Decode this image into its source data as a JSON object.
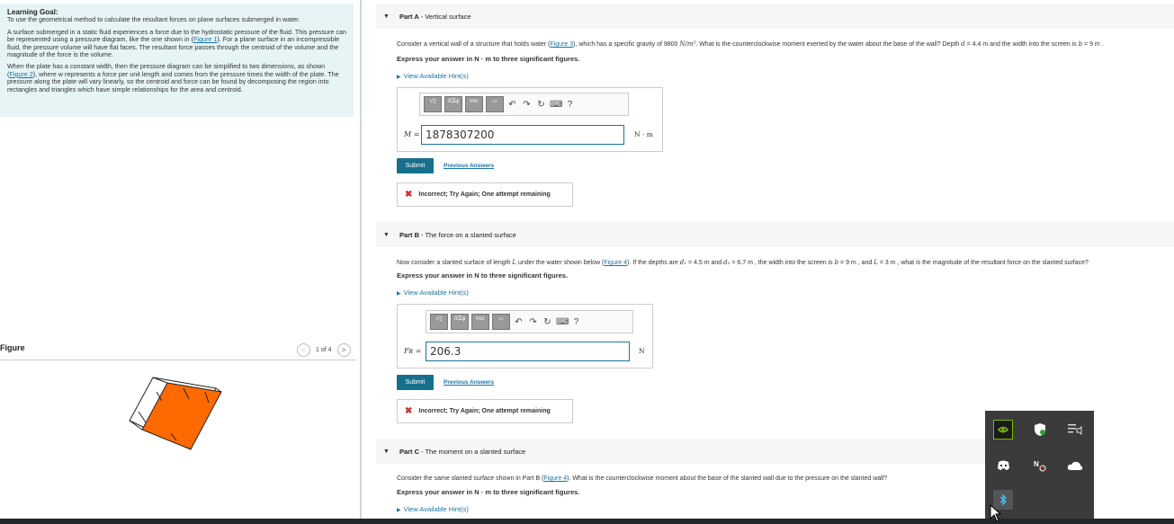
{
  "left": {
    "goal_head": "Learning Goal:",
    "goal_sub": "To use the geometrical method to calculate the resultant forces on plane surfaces submerged in water.",
    "p1_a": "A surface submerged in a static fluid experiences a force due to the hydrostatic pressure of the fluid. This pressure can be represented using a pressure diagram, like the one shown in (",
    "p1_link": "Figure 1",
    "p1_b": "). For a plane surface in an incompressible fluid, the pressure volume will have flat faces. The resultant force passes through the centroid of the volume and the magnitude of the force is the volume.",
    "p2_a": "When the plate has a constant width, then the pressure diagram can be simplified to two dimensions, as shown (",
    "p2_link": "Figure 2",
    "p2_b": "), where w represents a force per unit length and comes from the pressure times the width of the plate. The pressure along the plate will vary linearly, so the centroid and force can be found by decomposing the region into rectangles and triangles which have simple relationships for the area and centroid.",
    "figure_label": "Figure",
    "pager": "1 of 4",
    "prev_arrow": "<",
    "next_arrow": ">"
  },
  "partA": {
    "part": "Part A",
    "title": " - Vertical surface",
    "q_a": "Consider a vertical wall of a structure that holds water (",
    "q_link": "Figure 3",
    "q_b": "), which has a specific gravity of 9800 ",
    "q_unit": "N/m³",
    "q_c": ". What is the counterclockwise moment exerted by the water about the base of the wall? Depth ",
    "q_d": "d",
    "q_e": " = 4.4  m and the width into the screen is ",
    "q_f": "b",
    "q_g": " = 9  m .",
    "instruction": "Express your answer in N · m to three significant figures.",
    "hint": "View Available Hint(s)",
    "var": "M =",
    "value": "1878307200",
    "unit": "N · m",
    "submit": "Submit",
    "prev": "Previous Answers",
    "feedback": "Incorrect; Try Again; One attempt remaining"
  },
  "partB": {
    "part": "Part B",
    "title": " - The force on a slanted surface",
    "question": "Now consider a slanted surface of length L under the water shown below (Figure 4). If the depths are d₁ = 4.5  m and d₂ = 6.7  m , the width into the screen is b = 9  m , and L = 3  m , what is the magnitude of the resultant force on the slanted surface?",
    "q_a": "Now consider a slanted surface of length ",
    "q_L": "L",
    "q_b": " under the water shown below (",
    "q_link": "Figure 4",
    "q_c": "). If the depths are ",
    "q_d1": "d₁",
    "q_d": " = 4.5  m and ",
    "q_d2": "d₂",
    "q_e": " = 6.7  m , the width into the screen is ",
    "q_bv": "b",
    "q_f": " = 9  m , and ",
    "q_L2": "L",
    "q_g": " = 3  m , what is the magnitude of the resultant force on the slanted surface?",
    "instruction": "Express your answer in N to three significant figures.",
    "hint": "View Available Hint(s)",
    "var": "Fʀ =",
    "value": "206.3",
    "unit": "N",
    "submit": "Submit",
    "prev": "Previous Answers",
    "feedback": "Incorrect; Try Again; One attempt remaining"
  },
  "partC": {
    "part": "Part C",
    "title": " - The moment on a slanted surface",
    "q_a": "Consider the same slanted surface shown in Part B (",
    "q_link": "Figure 4",
    "q_b": "). What is the counterclockwise moment about the base of the slanted wall due to the pressure on the slanted wall?",
    "instruction": "Express your answer in N · m to three significant figures.",
    "hint": "View Available Hint(s)"
  },
  "toolbar": {
    "help": "?"
  },
  "colors": {
    "accent": "#16708c",
    "link": "#1a73a8",
    "error": "#d32f2f",
    "goal_bg": "#e6f4f5",
    "figure_fill": "#ff6a00"
  },
  "tray_icons": [
    "nvidia-icon",
    "security-shield-icon",
    "audio-settings-icon",
    "discord-icon",
    "onenote-icon",
    "onedrive-cloud-icon",
    "bluetooth-icon"
  ]
}
